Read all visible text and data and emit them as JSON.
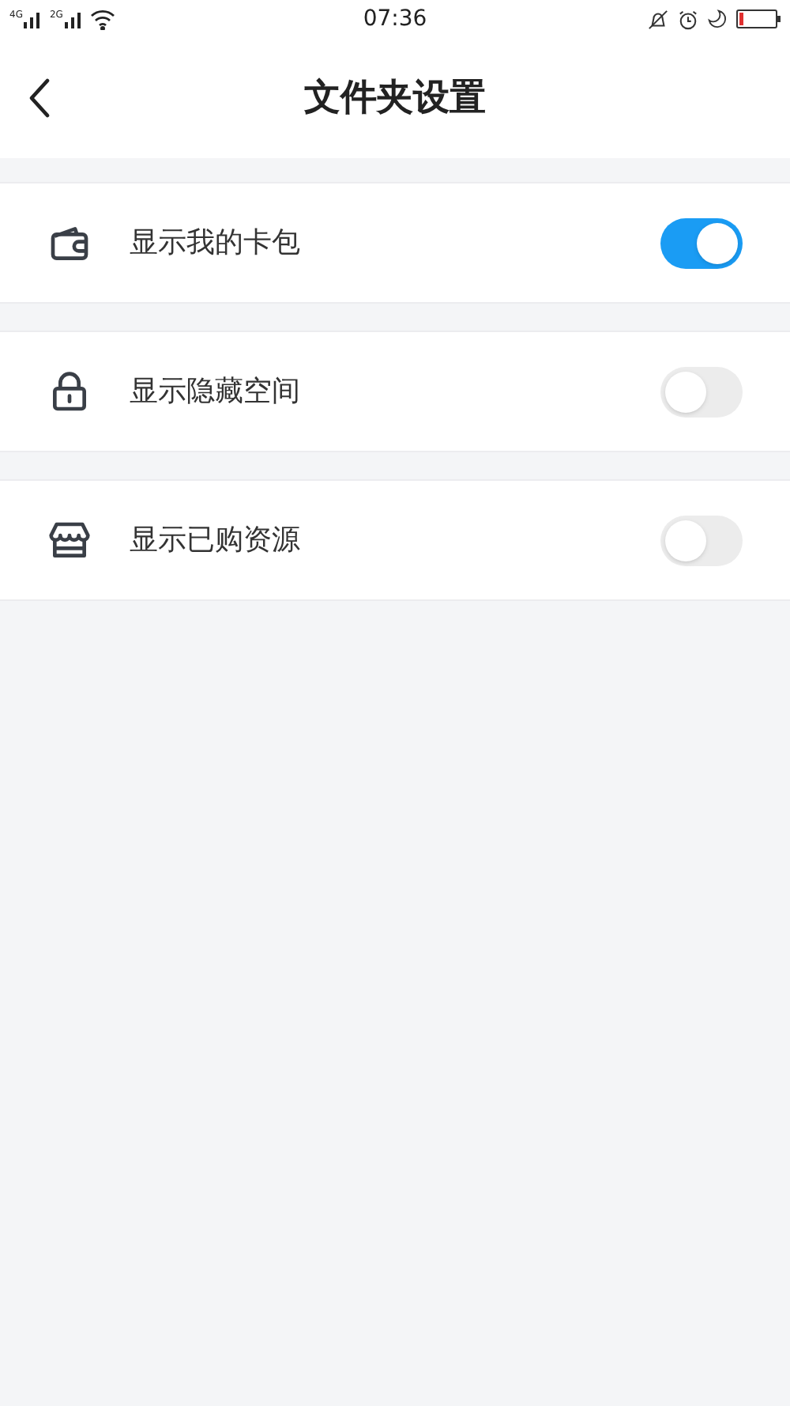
{
  "status_bar": {
    "network_1": "4G",
    "network_2": "2G",
    "time": "07:36"
  },
  "header": {
    "title": "文件夹设置"
  },
  "settings": [
    {
      "label": "显示我的卡包",
      "on": true
    },
    {
      "label": "显示隐藏空间",
      "on": false
    },
    {
      "label": "显示已购资源",
      "on": false
    }
  ]
}
